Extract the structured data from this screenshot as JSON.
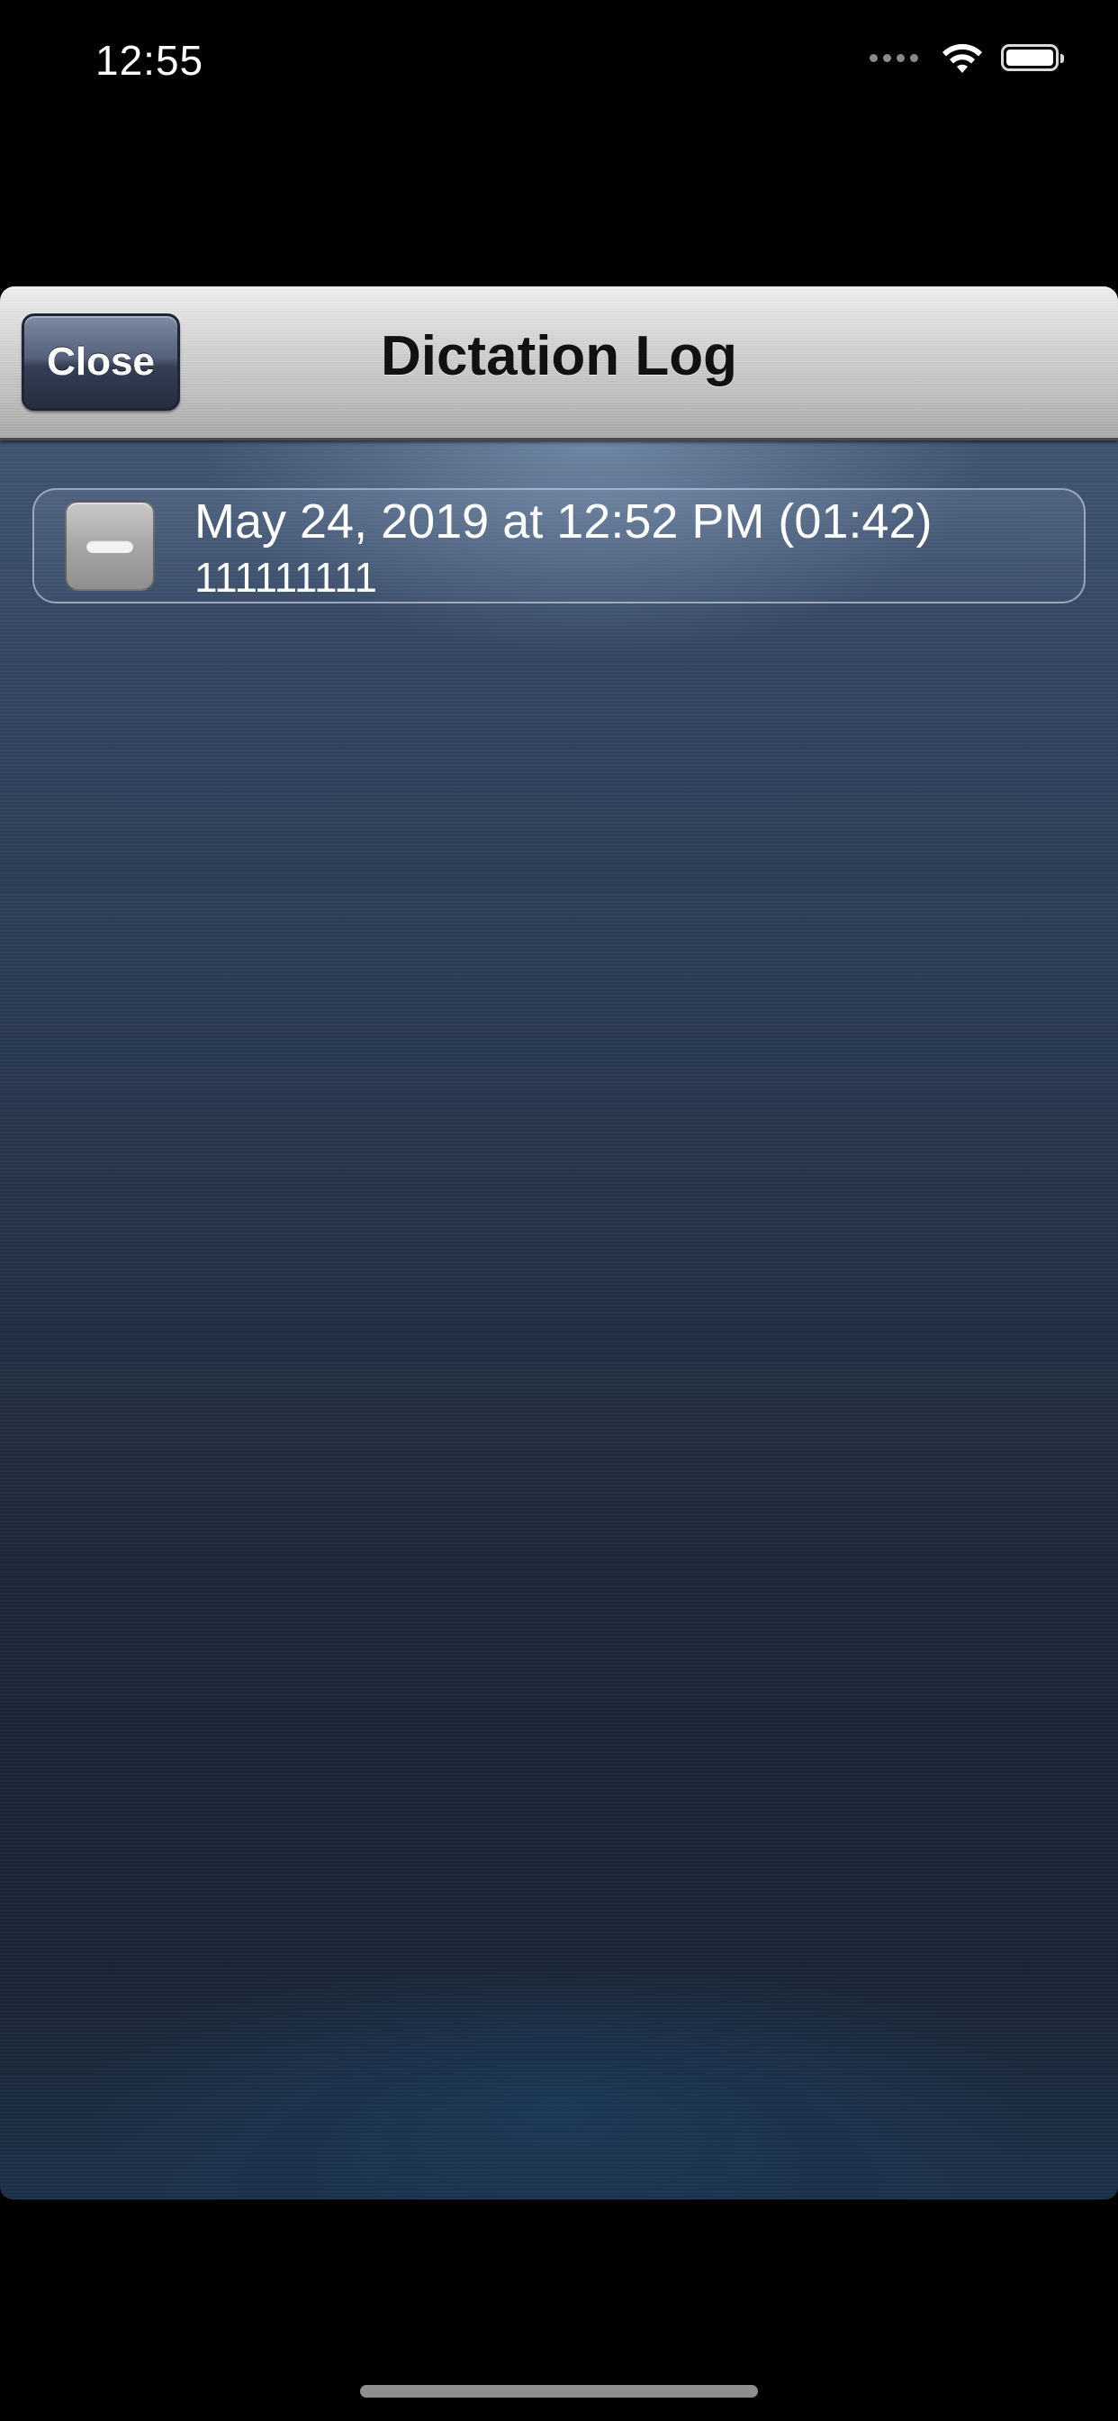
{
  "status_bar": {
    "time": "12:55",
    "icons": [
      "signal-dots-icon",
      "wifi-icon",
      "battery-icon"
    ]
  },
  "nav": {
    "title": "Dictation Log",
    "close_label": "Close"
  },
  "log": {
    "entries": [
      {
        "title": "May 24, 2019 at 12:52 PM (01:42)",
        "text": "111111111",
        "action_icon": "minus-icon"
      }
    ]
  },
  "colors": {
    "nav_bar": "#c4c4c4",
    "close_button": "#343e55",
    "background_top": "#4b6283",
    "background_bottom": "#1a2434"
  }
}
